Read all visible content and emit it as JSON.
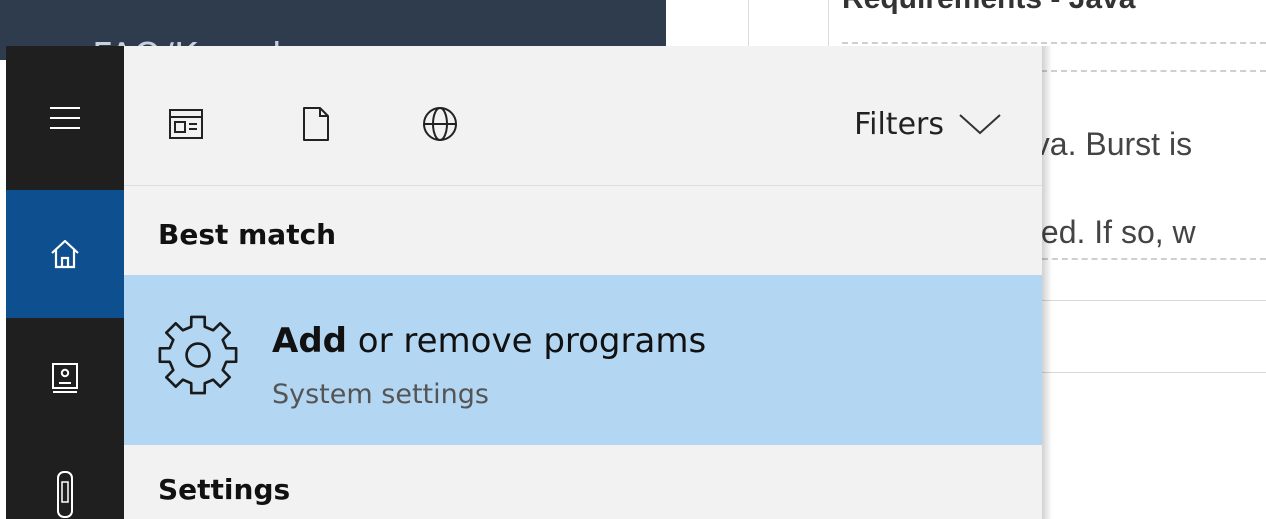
{
  "background_page": {
    "header_partial_text": "FAQ/Knowle",
    "heading_partial": "Requirements - Java",
    "text_line_1": "Java. Burst is",
    "text_line_2": "talled. If so, w"
  },
  "rail": {
    "items": [
      {
        "name": "menu",
        "icon": "hamburger-icon"
      },
      {
        "name": "home",
        "icon": "home-icon",
        "selected": true
      },
      {
        "name": "notebook",
        "icon": "notebook-icon"
      },
      {
        "name": "device",
        "icon": "device-icon"
      }
    ]
  },
  "toolbar": {
    "icons": [
      "apps-icon",
      "document-icon",
      "globe-icon"
    ],
    "filters_label": "Filters"
  },
  "results": {
    "best_match_heading": "Best match",
    "best_match": {
      "title_bold": "Add",
      "title_rest": " or remove programs",
      "subtitle": "System settings",
      "icon": "gear-icon"
    },
    "settings_heading": "Settings"
  },
  "colors": {
    "rail_background": "#1f1f1f",
    "rail_selected": "#0e4f8f",
    "flyout_background": "#f2f2f2",
    "result_highlight": "#b3d7f2"
  }
}
